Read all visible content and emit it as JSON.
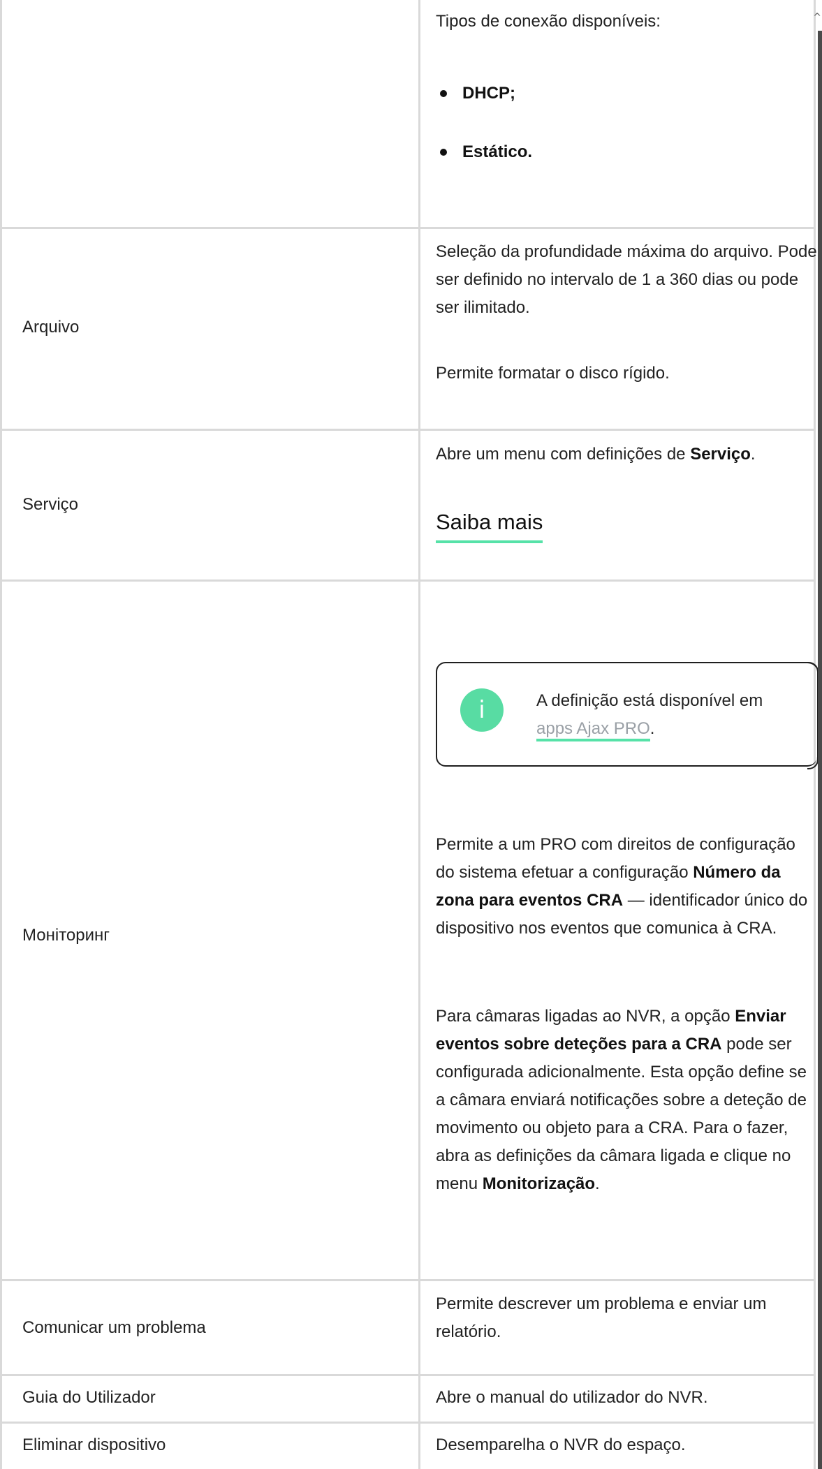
{
  "rows": {
    "connection": {
      "label": "",
      "intro": "Tipos de conexão disponíveis:",
      "bullets": [
        "DHCP;",
        "Estático."
      ]
    },
    "archive": {
      "label": "Arquivo",
      "desc1": "Seleção da profundidade máxima do arquivo. Pode ser definido no intervalo de 1 a 360 dias ou pode ser ilimitado.",
      "desc2": "Permite formatar o disco rígido."
    },
    "service": {
      "label": "Serviço",
      "desc_prefix": "Abre um menu com definições de ",
      "desc_bold": "Serviço",
      "desc_suffix": ".",
      "learn_more": "Saiba mais"
    },
    "monitoring": {
      "label": "Моніторинг",
      "info": {
        "icon": "info-icon",
        "text_prefix": "A definição está disponível em ",
        "link": "apps Ajax PRO",
        "text_suffix": "."
      },
      "p1_prefix": "Permite a um PRO com direitos de configuração do sistema efetuar a configuração ",
      "p1_bold": "Número da zona para eventos CRA",
      "p1_suffix": " — identificador único do dispositivo nos eventos que comunica à CRA.",
      "p2_prefix": "Para câmaras ligadas ao NVR, a opção ",
      "p2_bold": "Enviar eventos sobre deteções para a CRA",
      "p2_middle": " pode ser configurada adicionalmente. Esta opção define se a câmara enviará notificações sobre a deteção de movimento ou objeto para a CRA. Para o fazer, abra as definições da câmara ligada e clique no menu ",
      "p2_bold2": "Monitorização",
      "p2_suffix": "."
    },
    "report": {
      "label": "Comunicar um problema",
      "desc": "Permite descrever um problema e enviar um relatório."
    },
    "guide": {
      "label": "Guia do Utilizador",
      "desc": "Abre o manual do utilizador do NVR."
    },
    "delete": {
      "label": "Eliminar dispositivo",
      "desc": "Desemparelha o NVR do espaço."
    }
  },
  "colors": {
    "accent": "#56e2a8",
    "info_icon_bg": "#58dca3",
    "border": "#d9d9d9",
    "text": "#222222",
    "link_muted": "#9aa0a6"
  },
  "scrollbar": {
    "icon": "scroll-up-arrow-icon"
  }
}
